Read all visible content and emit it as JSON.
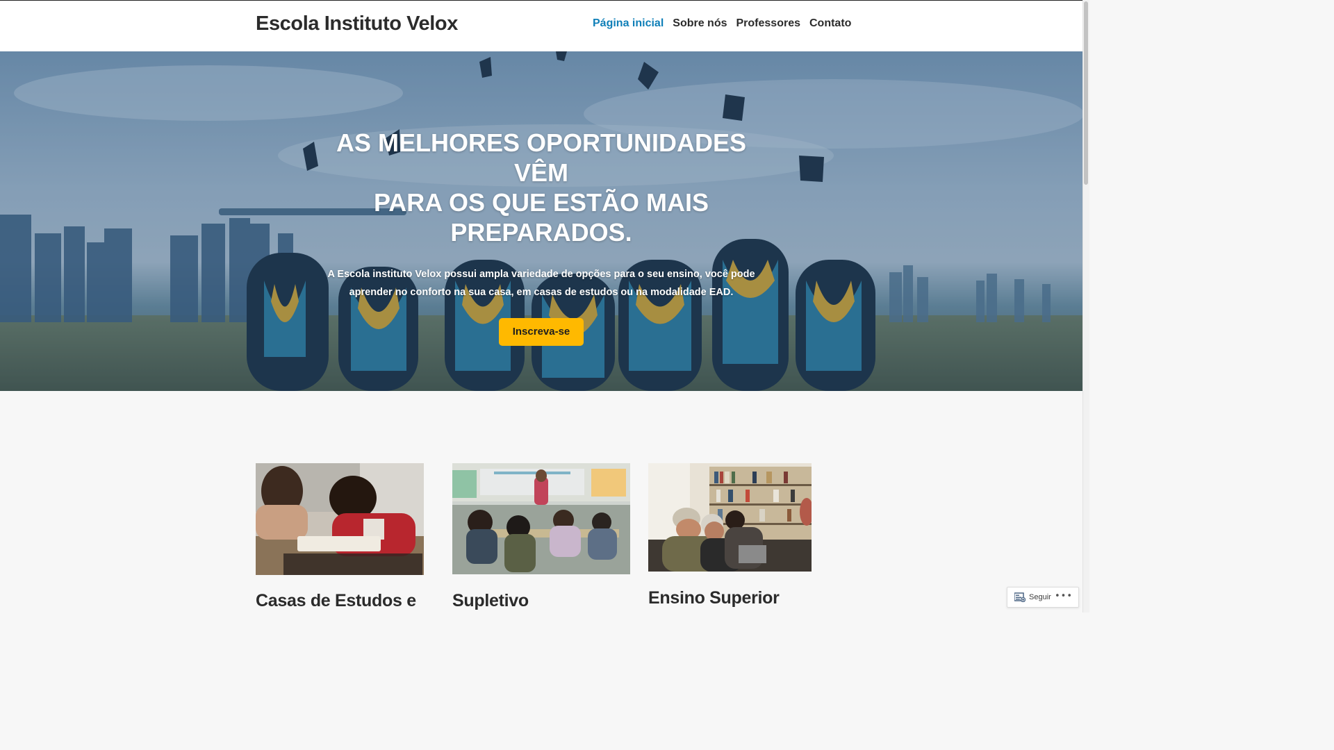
{
  "header": {
    "site_title": "Escola Instituto Velox",
    "nav": [
      {
        "label": "Página inicial",
        "active": true
      },
      {
        "label": "Sobre nós",
        "active": false
      },
      {
        "label": "Professores",
        "active": false
      },
      {
        "label": "Contato",
        "active": false
      }
    ]
  },
  "hero": {
    "title_lines": [
      "AS MELHORES OPORTUNIDADES VÊM",
      "PARA OS QUE ESTÃO MAIS",
      "PREPARADOS."
    ],
    "text_lines": [
      "A Escola instituto Velox possui ampla variedade de opções para o seu ensino, você pode",
      "aprender no conforto na sua casa, em casas de estudos ou na modalidade EAD."
    ],
    "button_label": "Inscreva-se"
  },
  "cards": [
    {
      "title": "Casas de Estudos e"
    },
    {
      "title": "Supletivo"
    },
    {
      "title": "Ensino Superior"
    }
  ],
  "follow_widget": {
    "label": "Seguir",
    "more": "•••"
  },
  "colors": {
    "nav_active": "#0f7fb8",
    "button_bg": "#ffb900",
    "title_text": "#2b2b2b"
  }
}
